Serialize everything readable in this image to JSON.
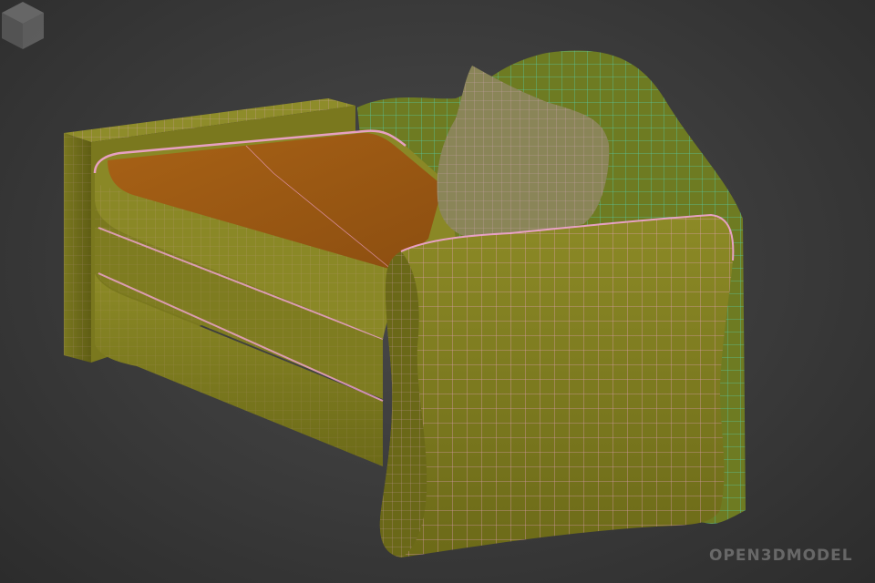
{
  "scene": {
    "subject": "sofa-bed-wireframe-render",
    "colors": {
      "background": "#3a3a3a",
      "upholstery": "#7b7a1e",
      "cushion_top": "#9a5a16",
      "wire_edges": "#f2a4d4",
      "wire_back": "#4fe0c8",
      "pillow": "#8a8558"
    }
  },
  "watermark": {
    "text": "OPEN3DMODEL",
    "logo": "cube-icon"
  }
}
